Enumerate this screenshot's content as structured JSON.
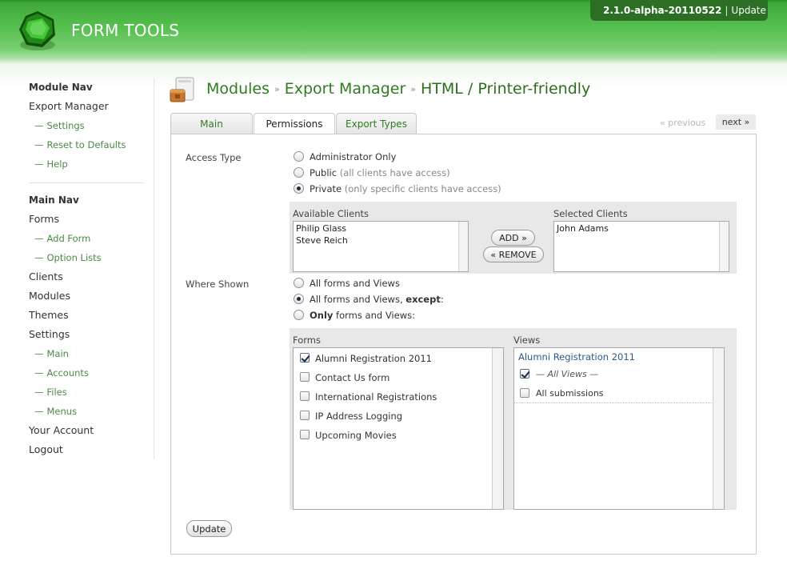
{
  "app": {
    "logo_text": "FORM TOOLS",
    "version": "2.1.0-alpha-20110522",
    "update_link": "Update"
  },
  "nav": {
    "module_heading": "Module Nav",
    "module_title": "Export Manager",
    "module_items": [
      "Settings",
      "Reset to Defaults",
      "Help"
    ],
    "main_heading": "Main Nav",
    "forms": "Forms",
    "forms_items": [
      "Add Form",
      "Option Lists"
    ],
    "clients": "Clients",
    "modules": "Modules",
    "themes": "Themes",
    "settings": "Settings",
    "settings_items": [
      "Main",
      "Accounts",
      "Files",
      "Menus"
    ],
    "your_account": "Your Account",
    "logout": "Logout"
  },
  "breadcrumb": {
    "parts": [
      "Modules",
      "Export Manager",
      "HTML / Printer-friendly"
    ],
    "separator": "»"
  },
  "tabs": [
    {
      "label": "Main",
      "active": false
    },
    {
      "label": "Permissions",
      "active": true
    },
    {
      "label": "Export Types",
      "active": false
    }
  ],
  "pager": {
    "previous": "« previous",
    "next": "next »"
  },
  "access": {
    "label": "Access Type",
    "options": [
      {
        "label": "Administrator Only",
        "hint": "",
        "selected": false
      },
      {
        "label": "Public",
        "hint": "(all clients have access)",
        "selected": false
      },
      {
        "label": "Private",
        "hint": "(only specific clients have access)",
        "selected": true
      }
    ]
  },
  "clients": {
    "available_title": "Available Clients",
    "available": [
      "Philip Glass",
      "Steve Reich"
    ],
    "selected_title": "Selected Clients",
    "selected": [
      "John Adams"
    ],
    "add_button": "ADD »",
    "remove_button": "« REMOVE"
  },
  "where": {
    "label": "Where Shown",
    "opt1": "All forms and Views",
    "opt2_main": "All forms and Views, ",
    "opt2_bold": "except",
    "opt2_end": ":",
    "opt3_bold": "Only",
    "opt3_rest": " forms and Views:",
    "selected_index": 1
  },
  "forms_list": {
    "title": "Forms",
    "items": [
      {
        "label": "Alumni Registration 2011",
        "checked": true
      },
      {
        "label": "Contact Us form",
        "checked": false
      },
      {
        "label": "International Registrations",
        "checked": false
      },
      {
        "label": "IP Address Logging",
        "checked": false
      },
      {
        "label": "Upcoming Movies",
        "checked": false
      }
    ]
  },
  "views_list": {
    "title": "Views",
    "form_name": "Alumni Registration 2011",
    "items": [
      {
        "label": "— All Views —",
        "checked": true
      },
      {
        "label": "All submissions",
        "checked": false
      }
    ]
  },
  "update_button": "Update",
  "colors": {
    "brand_green": "#2e7d1f",
    "header_green": "#53bd4c",
    "version_box": "#2b6e24",
    "link_blue": "#2a5a8c"
  }
}
